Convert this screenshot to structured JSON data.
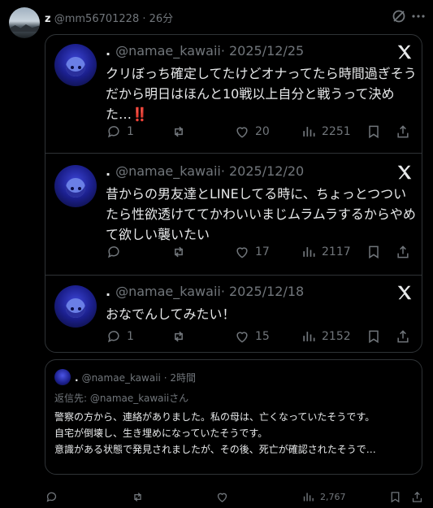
{
  "header": {
    "name": "z",
    "handle": "@mm56701228",
    "time": "· 26分",
    "icons": [
      "grok-icon",
      "more-icon"
    ]
  },
  "quote_posts": [
    {
      "dot": ".",
      "handle": "@namae_kawaii",
      "date": "· 2025/12/25",
      "text": "クリぼっち確定してたけどオナってたら時間過ぎそうだから明日はほんと10戦以上自分と戦うって決めた…‼️",
      "replies": "1",
      "reposts": "",
      "likes": "20",
      "views": "2251"
    },
    {
      "dot": ".",
      "handle": "@namae_kawaii",
      "date": "· 2025/12/20",
      "text": "昔からの男友達とLINEしてる時に、ちょっとつついたら性欲透けててかわいいまじムラムラするからやめて欲しい襲いたい",
      "replies": "",
      "reposts": "",
      "likes": "17",
      "views": "2117"
    },
    {
      "dot": ".",
      "handle": "@namae_kawaii",
      "date": "· 2025/12/18",
      "text": "おなでんしてみたい！",
      "replies": "1",
      "reposts": "",
      "likes": "15",
      "views": "2152"
    }
  ],
  "embed": {
    "dot": ".",
    "handle": "@namae_kawaii",
    "time": "· 2時間",
    "reply_to": "返信先: @namae_kawaiiさん",
    "text": "警察の方から、連絡がありました。私の母は、亡くなっていたそうです。\n自宅が倒壊し、生き埋めになっていたそうです。\n意識がある状態で発見されましたが、その後、死亡が確認されたそうで…"
  },
  "bottom_actions": {
    "views": "2,767"
  },
  "colors": {
    "background": "#000000",
    "text": "#e7e9ea",
    "muted": "#71767b",
    "border": "#2f3336"
  }
}
